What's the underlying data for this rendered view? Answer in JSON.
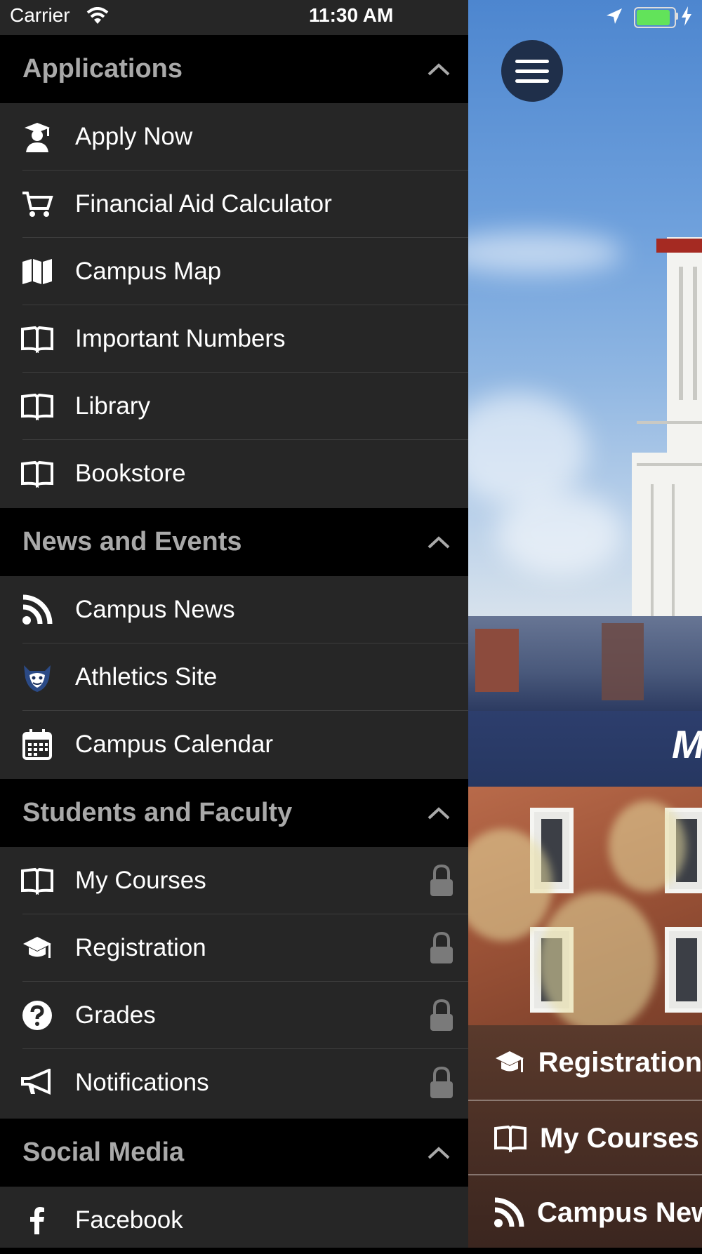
{
  "status_bar": {
    "carrier": "Carrier",
    "time": "11:30 AM"
  },
  "drawer": {
    "sections": [
      {
        "title": "Applications",
        "items": [
          {
            "label": "Apply Now",
            "icon": "graduate-user-icon"
          },
          {
            "label": "Financial Aid Calculator",
            "icon": "cart-icon"
          },
          {
            "label": "Campus Map",
            "icon": "map-icon"
          },
          {
            "label": "Important Numbers",
            "icon": "book-icon"
          },
          {
            "label": "Library",
            "icon": "book-icon"
          },
          {
            "label": "Bookstore",
            "icon": "book-icon"
          }
        ]
      },
      {
        "title": "News and Events",
        "items": [
          {
            "label": "Campus News",
            "icon": "rss-icon"
          },
          {
            "label": "Athletics Site",
            "icon": "mascot-logo-icon"
          },
          {
            "label": "Campus Calendar",
            "icon": "calendar-icon"
          }
        ]
      },
      {
        "title": "Students and Faculty",
        "items": [
          {
            "label": "My Courses",
            "icon": "book-icon",
            "locked": true
          },
          {
            "label": "Registration",
            "icon": "graduation-cap-icon",
            "locked": true
          },
          {
            "label": "Grades",
            "icon": "question-circle-icon",
            "locked": true
          },
          {
            "label": "Notifications",
            "icon": "megaphone-icon",
            "locked": true
          }
        ]
      },
      {
        "title": "Social Media",
        "items": [
          {
            "label": "Facebook",
            "icon": "facebook-icon"
          }
        ]
      }
    ]
  },
  "home": {
    "banner_text": "M",
    "quick_links": [
      {
        "label": "Registration",
        "icon": "graduation-cap-icon"
      },
      {
        "label": "My Courses",
        "icon": "book-icon"
      },
      {
        "label": "Campus New",
        "icon": "rss-icon"
      }
    ]
  },
  "colors": {
    "drawer_bg": "#262626",
    "section_header_bg": "#000000",
    "section_title": "#a9a9a9",
    "menu_button_bg": "#1f2f4a",
    "battery_green": "#62e35a"
  },
  "battery_level": 0.9
}
